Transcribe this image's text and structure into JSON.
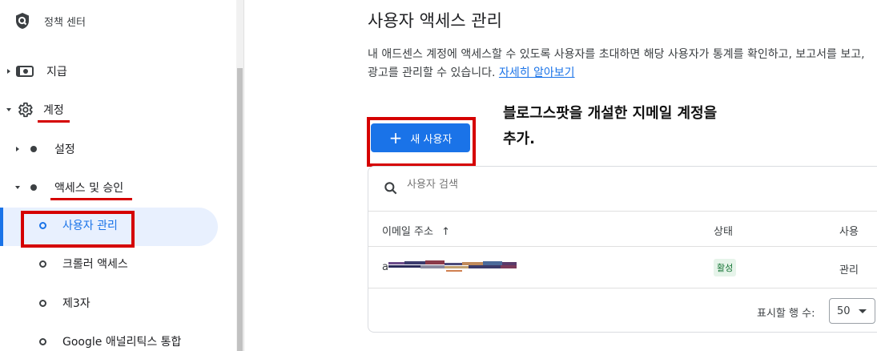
{
  "sidebar": {
    "brand": "정책 센터",
    "items": {
      "payments": "지급",
      "account": "계정",
      "settings": "설정",
      "access": "액세스 및 승인",
      "user_management": "사용자 관리",
      "crawler_access": "크롤러 액세스",
      "third_party": "제3자",
      "analytics": "Google 애널리틱스 통합"
    }
  },
  "main": {
    "title": "사용자 액세스 관리",
    "description": "내 애드센스 계정에 액세스할 수 있도록 사용자를 초대하면 해당 사용자가 통계를 확인하고, 보고서를 보고, 광고를 관리할 수 있습니다.",
    "learn_more": "자세히 알아보기",
    "add_user_label": "새 사용자",
    "annotation_line1": "블로그스팟을 개설한 지메일 계정을",
    "annotation_line2": "추가.",
    "search_placeholder": "사용자 검색",
    "table": {
      "headers": [
        "이메일 주소",
        "상태",
        "사용"
      ],
      "sort_indicator": "↑",
      "rows": [
        {
          "email_prefix": "a",
          "status": "활성",
          "role": "관리"
        }
      ]
    },
    "footer": {
      "rows_per_page_label": "표시할 행 수:",
      "rows_per_page_value": "50"
    }
  },
  "colors": {
    "accent": "#1a73e8",
    "annotation_red": "#d50000",
    "active_bg": "#e8f0fe",
    "status_green_bg": "#e6f4ea",
    "status_green_text": "#137333"
  }
}
